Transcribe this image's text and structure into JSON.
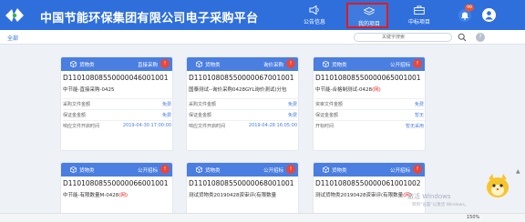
{
  "header": {
    "title": "中国节能环保集团有限公司电子采购平台",
    "nav": [
      {
        "label": "公告信息",
        "icon": "speaker-icon"
      },
      {
        "label": "我的项目",
        "icon": "layers-icon"
      },
      {
        "label": "中标项目",
        "icon": "briefcase-icon"
      }
    ],
    "notification_count": "99",
    "accent_color": "#2f6fdc",
    "highlight_color": "#e21b1b"
  },
  "filter": {
    "all_label": "全部",
    "search_placeholder": "关键字搜索",
    "help_label": "?"
  },
  "cards": [
    {
      "category": "货物类",
      "method": "直接采购",
      "flag": "!",
      "code": "D11010808550000046001001",
      "name": "中节能-直接采购-0425",
      "name_suffix": "",
      "rows": [
        {
          "k": "采购文件金额",
          "v": "免费"
        },
        {
          "k": "保证金金额",
          "v": "免费"
        },
        {
          "k": "响应文件开启时间",
          "v": "2019-04-30 17:00:00"
        }
      ]
    },
    {
      "category": "货物类",
      "method": "询价采购",
      "flag": "!",
      "code": "D11010808550000067001001",
      "name": "国泰测试--询价采购0428GYL询价测试(分包",
      "name_suffix": "",
      "rows": [
        {
          "k": "采购文件金额",
          "v": "免费"
        },
        {
          "k": "保证金金额",
          "v": "免费"
        },
        {
          "k": "响应文件开启时间",
          "v": "2019-04-28 16:05:00"
        }
      ]
    },
    {
      "category": "货物类",
      "method": "公开招标",
      "flag": "!",
      "code": "D11010808550000065001001",
      "name": "中节能-合格制测试-0428",
      "name_suffix": "(网)",
      "rows": [
        {
          "k": "资审文件金额",
          "v": "免费"
        },
        {
          "k": "保证金金额",
          "v": "暂无"
        },
        {
          "k": "开标时间",
          "v": "暂无采用"
        }
      ]
    },
    {
      "category": "货物类",
      "method": "公开招标",
      "flag": "!",
      "code": "D11010808550000066001001",
      "name": "中节能-有限数量M-0428",
      "name_suffix": "(网)",
      "rows": []
    },
    {
      "category": "货物类",
      "method": "公开招标",
      "flag": "!",
      "code": "D11010808550000068001001",
      "name": "测试货物类20190428资审评(有限数量",
      "name_suffix": "",
      "rows": []
    },
    {
      "category": "货物类",
      "method": "公开招标",
      "flag": "!",
      "code": "D11010808550000061001002",
      "name": "测试货物类20190428资审评(有限数量",
      "name_suffix": "(网)",
      "rows": []
    }
  ],
  "system": {
    "watermark_line1": "激活 Windows",
    "watermark_line2": "转到“设置”以激活 Windows。",
    "zoom": "150%"
  }
}
